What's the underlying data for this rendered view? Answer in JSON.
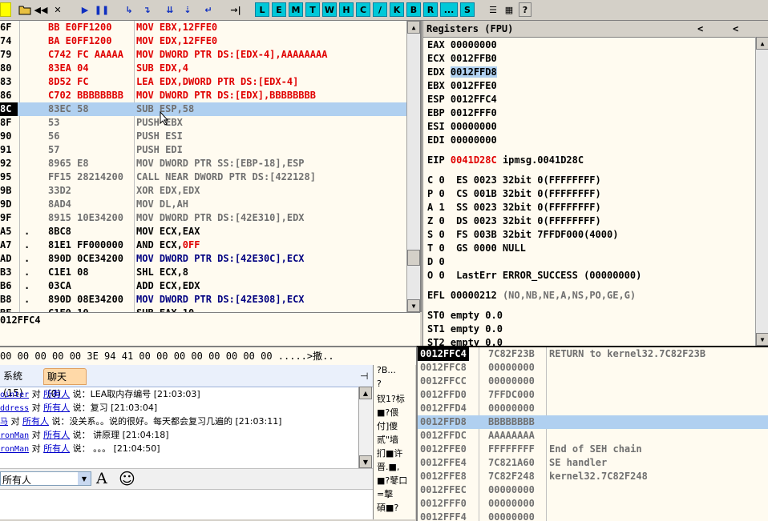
{
  "toolbar": {
    "letters": [
      "L",
      "E",
      "M",
      "T",
      "W",
      "H",
      "C",
      "/",
      "K",
      "B",
      "R",
      "...",
      "S"
    ]
  },
  "cpu": {
    "rows": [
      {
        "addr": "6F",
        "hex": "BB E0FF1200",
        "asm": "MOV EBX,12FFE0",
        "color": "#e00000"
      },
      {
        "addr": "74",
        "hex": "BA E0FF1200",
        "asm": "MOV EDX,12FFE0",
        "color": "#e00000"
      },
      {
        "addr": "79",
        "hex": "C742 FC AAAAA",
        "asm": "MOV DWORD PTR DS:[EDX-4],AAAAAAAA",
        "color": "#e00000"
      },
      {
        "addr": "80",
        "hex": "83EA 04",
        "asm": "SUB EDX,4",
        "color": "#e00000"
      },
      {
        "addr": "83",
        "hex": "8D52 FC",
        "asm": "LEA EDX,DWORD PTR DS:[EDX-4]",
        "color": "#e00000"
      },
      {
        "addr": "86",
        "hex": "C702 BBBBBBBB",
        "asm": "MOV DWORD PTR DS:[EDX],BBBBBBBB",
        "color": "#e00000"
      },
      {
        "addr": "8C",
        "hex": "83EC 58",
        "asm": "SUB ESP,58",
        "color": "#707070",
        "sel": true,
        "cur": true
      },
      {
        "addr": "8F",
        "hex": "53",
        "asm": "PUSH EBX",
        "color": "#707070"
      },
      {
        "addr": "90",
        "hex": "56",
        "asm": "PUSH ESI",
        "color": "#707070"
      },
      {
        "addr": "91",
        "hex": "57",
        "asm": "PUSH EDI",
        "color": "#707070"
      },
      {
        "addr": "92",
        "hex": "8965 E8",
        "asm": "MOV DWORD PTR SS:[EBP-18],ESP",
        "color": "#707070"
      },
      {
        "addr": "95",
        "hex": "FF15 28214200",
        "asm": "CALL NEAR DWORD PTR DS:[422128]",
        "color": "#707070"
      },
      {
        "addr": "9B",
        "hex": "33D2",
        "asm": "XOR EDX,EDX",
        "color": "#707070"
      },
      {
        "addr": "9D",
        "hex": "8AD4",
        "asm": "MOV DL,AH",
        "color": "#707070"
      },
      {
        "addr": "9F",
        "hex": "8915 10E34200",
        "asm": "MOV DWORD PTR DS:[42E310],EDX",
        "color": "#707070"
      },
      {
        "addr": "A5",
        "mark": ".",
        "hex": "8BC8",
        "asm": "MOV ECX,EAX",
        "color": "#000000"
      },
      {
        "addr": "A7",
        "mark": ".",
        "hex": "81E1 FF000000",
        "asm": "AND ECX,0FF",
        "color": "#000000",
        "imm": "0FF"
      },
      {
        "addr": "AD",
        "mark": ".",
        "hex": "890D 0CE34200",
        "asm": "MOV DWORD PTR DS:[42E30C],ECX",
        "color": "#000000",
        "blue": true
      },
      {
        "addr": "B3",
        "mark": ".",
        "hex": "C1E1 08",
        "asm": "SHL ECX,8",
        "color": "#000000"
      },
      {
        "addr": "B6",
        "mark": ".",
        "hex": "03CA",
        "asm": "ADD ECX,EDX",
        "color": "#000000"
      },
      {
        "addr": "B8",
        "mark": ".",
        "hex": "890D 08E34200",
        "asm": "MOV DWORD PTR DS:[42E308],ECX",
        "color": "#000000",
        "blue": true
      },
      {
        "addr": "BE",
        "mark": ".",
        "hex": "C1E0 10",
        "asm": "SUB EAX,10",
        "color": "#000000"
      }
    ],
    "info": "012FFC4"
  },
  "registers": {
    "title": "Registers (FPU)",
    "nav_left": "<",
    "nav_left2": "<",
    "gp": [
      {
        "name": "EAX",
        "value": "00000000"
      },
      {
        "name": "ECX",
        "value": "0012FFB0"
      },
      {
        "name": "EDX",
        "value": "0012FFD8",
        "sel": true
      },
      {
        "name": "EBX",
        "value": "0012FFE0"
      },
      {
        "name": "ESP",
        "value": "0012FFC4"
      },
      {
        "name": "EBP",
        "value": "0012FFF0"
      },
      {
        "name": "ESI",
        "value": "00000000"
      },
      {
        "name": "EDI",
        "value": "00000000"
      }
    ],
    "eip": {
      "name": "EIP",
      "value": "0041D28C",
      "comment": "ipmsg.0041D28C"
    },
    "flags": [
      "C 0  ES 0023 32bit 0(FFFFFFFF)",
      "P 0  CS 001B 32bit 0(FFFFFFFF)",
      "A 1  SS 0023 32bit 0(FFFFFFFF)",
      "Z 0  DS 0023 32bit 0(FFFFFFFF)",
      "S 0  FS 003B 32bit 7FFDF000(4000)",
      "T 0  GS 0000 NULL",
      "D 0",
      "O 0  LastErr ERROR_SUCCESS (00000000)"
    ],
    "efl": {
      "name": "EFL",
      "value": "00000212",
      "comment": "(NO,NB,NE,A,NS,PO,GE,G)"
    },
    "fpu": [
      "ST0 empty 0.0",
      "ST1 empty 0.0",
      "ST2 empty 0.0"
    ]
  },
  "dump": {
    "row": "00 00 00 00 00 3E 94 41 00 00 00 00 00 00 00 00 .....>撒.."
  },
  "log": {
    "tab_system": "系统 (15)",
    "tab_chat": "聊天 (0)",
    "pin": "⊣",
    "lines": [
      {
        "name": "ointer",
        "mid": " 对 ",
        "target": "所有人",
        "msg": " 说：LEA取内存编号 [21:03:03]"
      },
      {
        "name": "ddress",
        "mid": " 对 ",
        "target": "所有人",
        "msg": " 说：复习 [21:03:04]"
      },
      {
        "name": "马",
        "mid": " 对 ",
        "target": "所有人",
        "msg": " 说：没关系。。说的很好。每天都会复习几遍的 [21:03:11]"
      },
      {
        "name": "ronMan",
        "mid": " 对 ",
        "target": "所有人",
        "msg": " 说： 讲原理 [21:04:18]"
      },
      {
        "name": "ronMan",
        "mid": " 对 ",
        "target": "所有人",
        "msg": " 说： 。。。 [21:04:50]"
      }
    ],
    "recipient": "所有人",
    "font_icon": "A",
    "emoji_icon": "☺"
  },
  "midcol": [
    "?B...",
    "?",
    "钗1?标",
    "■?偎",
    "付]傻",
    "贰\"墙",
    "扪■许",
    "晋.■,",
    "■?鼕口",
    "=擊",
    "碩■?"
  ],
  "stack": {
    "rows": [
      {
        "addr": "0012FFC4",
        "val": "7C82F23B",
        "cmt": "RETURN to kernel32.7C82F23B",
        "cur": true
      },
      {
        "addr": "0012FFC8",
        "val": "00000000",
        "cmt": ""
      },
      {
        "addr": "0012FFCC",
        "val": "00000000",
        "cmt": ""
      },
      {
        "addr": "0012FFD0",
        "val": "7FFDC000",
        "cmt": ""
      },
      {
        "addr": "0012FFD4",
        "val": "00000000",
        "cmt": ""
      },
      {
        "addr": "0012FFD8",
        "val": "BBBBBBBB",
        "cmt": "",
        "sel": true
      },
      {
        "addr": "0012FFDC",
        "val": "AAAAAAAA",
        "cmt": ""
      },
      {
        "addr": "0012FFE0",
        "val": "FFFFFFFF",
        "cmt": "End of SEH chain"
      },
      {
        "addr": "0012FFE4",
        "val": "7C821A60",
        "cmt": "SE handler"
      },
      {
        "addr": "0012FFE8",
        "val": "7C82F248",
        "cmt": "kernel32.7C82F248"
      },
      {
        "addr": "0012FFEC",
        "val": "00000000",
        "cmt": ""
      },
      {
        "addr": "0012FFF0",
        "val": "00000000",
        "cmt": ""
      },
      {
        "addr": "0012FFF4",
        "val": "00000000",
        "cmt": ""
      }
    ]
  }
}
